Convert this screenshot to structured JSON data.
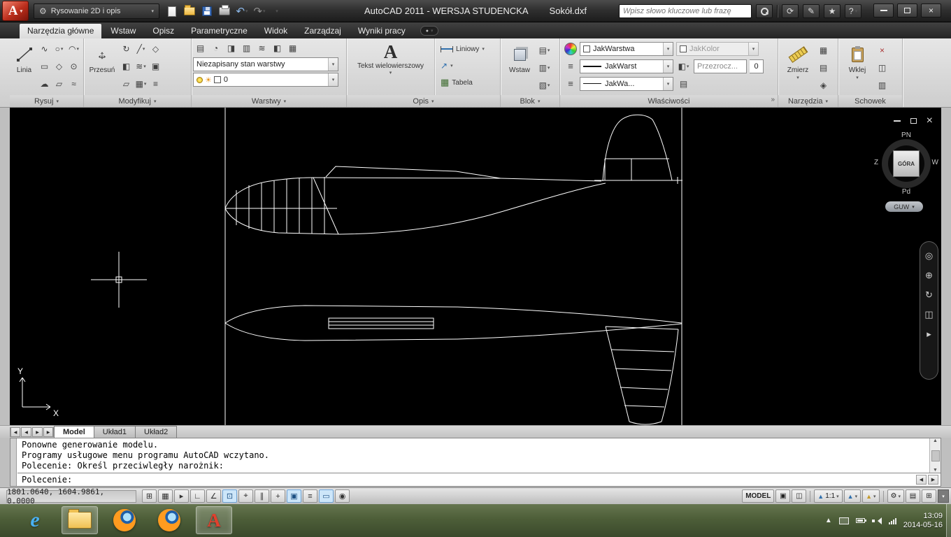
{
  "title_bar": {
    "app_initial": "A",
    "workspace_label": "Rysowanie 2D i opis",
    "app_title": "AutoCAD 2011 - WERSJA STUDENCKA",
    "doc_name": "Sokół.dxf",
    "search_placeholder": "Wpisz słowo kluczowe lub frazę"
  },
  "icons": {
    "undo": "↶",
    "redo": "↷",
    "star": "★",
    "help": "?",
    "gear": "⚙"
  },
  "ribbon_tabs": [
    {
      "label": "Narzędzia główne",
      "active": true
    },
    {
      "label": "Wstaw",
      "active": false
    },
    {
      "label": "Opisz",
      "active": false
    },
    {
      "label": "Parametryczne",
      "active": false
    },
    {
      "label": "Widok",
      "active": false
    },
    {
      "label": "Zarządzaj",
      "active": false
    },
    {
      "label": "Wyniki pracy",
      "active": false
    }
  ],
  "panels": {
    "rysuj": {
      "label": "Rysuj",
      "linia": "Linia"
    },
    "modyfikuj": {
      "label": "Modyfikuj",
      "przesun": "Przesuń"
    },
    "warstwy": {
      "label": "Warstwy",
      "layer_state": "Niezapisany stan warstwy",
      "layer_current": "0"
    },
    "opis": {
      "label": "Opis",
      "mtext_icon": "A",
      "mtext": "Tekst wielowierszowy",
      "dim_linear": "Liniowy",
      "table": "Tabela"
    },
    "blok": {
      "label": "Blok",
      "wstaw": "Wstaw"
    },
    "wlasciwosci": {
      "label": "Właściwości",
      "expand": "»",
      "obj_color": "JakWarstwa",
      "dim_color": "JakKolor",
      "lineweight": "JakWarst",
      "transparency_label": "Przezrocz...",
      "transparency_value": "0",
      "linetype": "JakWa..."
    },
    "narzedzia": {
      "label": "Narzędzia",
      "zmierz": "Zmierz"
    },
    "schowek": {
      "label": "Schowek",
      "wklej": "Wklej"
    }
  },
  "canvas": {
    "viewcube": {
      "north": "PN",
      "east": "W",
      "west": "Z",
      "south": "Pd",
      "face": "GÓRA",
      "ucs_button": "GUW"
    },
    "ucs": {
      "x": "X",
      "y": "Y"
    }
  },
  "layout_bar": {
    "tabs": [
      {
        "label": "Model",
        "active": true
      },
      {
        "label": "Układ1",
        "active": false
      },
      {
        "label": "Układ2",
        "active": false
      }
    ]
  },
  "command_window": {
    "history": [
      "Ponowne generowanie modelu.",
      "Programy usługowe menu programu AutoCAD wczytano.",
      "Polecenie: Określ przeciwległy narożnik:"
    ],
    "prompt": "Polecenie:"
  },
  "status_bar": {
    "coordinates": "1801.0640, 1604.9861, 0.0000",
    "toggles": [
      "⊞",
      "▦",
      "▸",
      "∟",
      "∠",
      "⊡",
      "⌖",
      "∥",
      "+",
      "▣",
      "≡",
      "▭",
      "◉"
    ],
    "model_button": "MODEL",
    "annotation_scale": "1:1"
  },
  "taskbar": {
    "clock_time": "13:09",
    "clock_date": "2014-05-16"
  }
}
